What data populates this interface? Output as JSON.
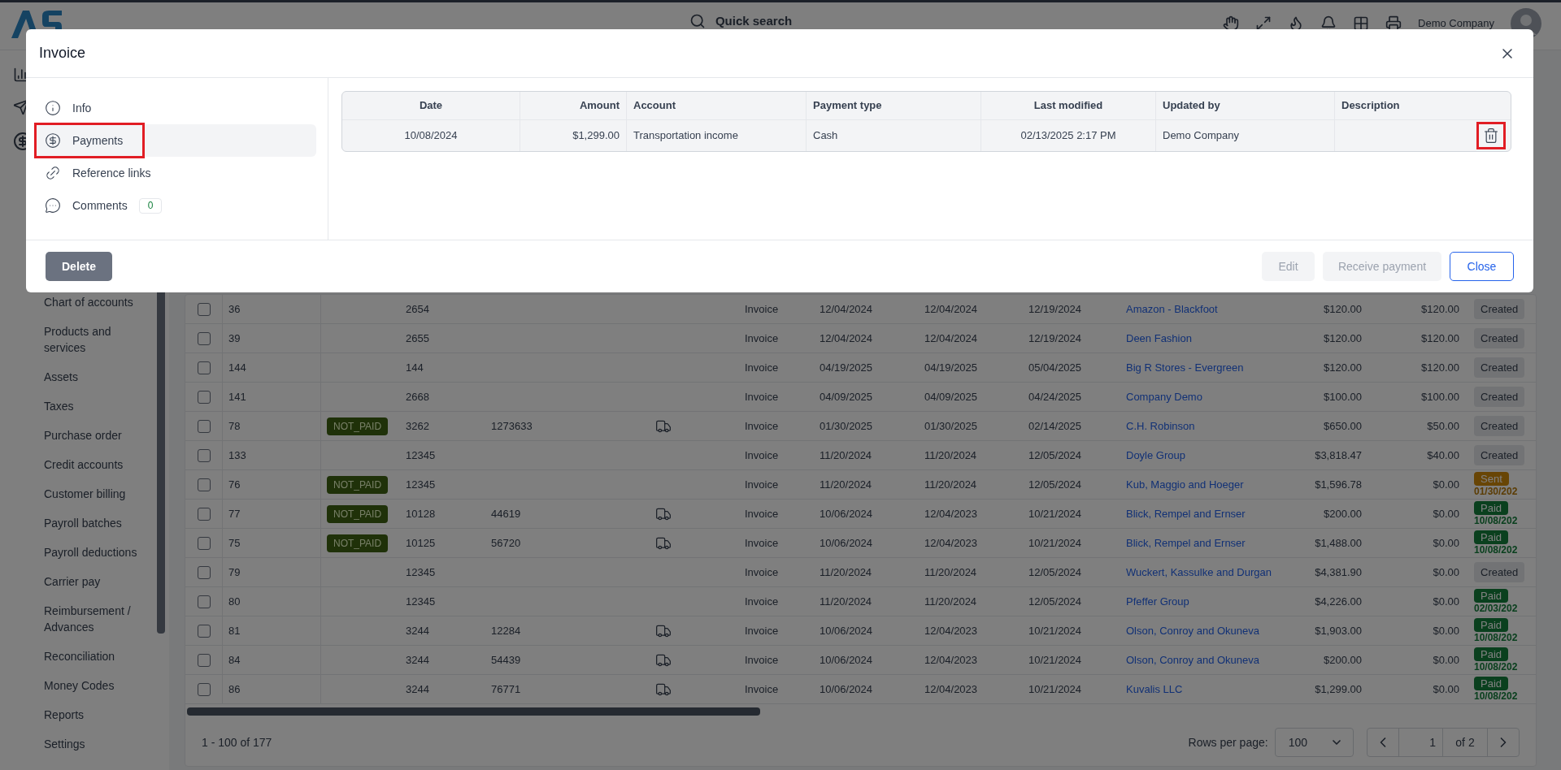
{
  "top_bar": {
    "search_placeholder": "Quick search",
    "company": "Demo Company"
  },
  "sidebar": {
    "items": [
      {
        "label": "Chart of accounts"
      },
      {
        "label": "Products and services"
      },
      {
        "label": "Assets"
      },
      {
        "label": "Taxes"
      },
      {
        "label": "Purchase order"
      },
      {
        "label": "Credit accounts"
      },
      {
        "label": "Customer billing"
      },
      {
        "label": "Payroll batches"
      },
      {
        "label": "Payroll deductions"
      },
      {
        "label": "Carrier pay"
      },
      {
        "label": "Reimbursement / Advances"
      },
      {
        "label": "Reconciliation"
      },
      {
        "label": "Money Codes"
      },
      {
        "label": "Reports"
      },
      {
        "label": "Settings"
      }
    ]
  },
  "table": {
    "rows": [
      {
        "checked": false,
        "column_1": "36",
        "column_3": "2654",
        "truck": false,
        "column_6": "Invoice",
        "column_7": "12/04/2024",
        "column_8": "12/04/2024",
        "column_9": "12/19/2024",
        "customer": "Amazon - Blackfoot",
        "amount": "$120.00",
        "balance": "$120.00",
        "status": {
          "kind": "created",
          "label": "Created"
        }
      },
      {
        "checked": false,
        "column_1": "39",
        "column_3": "2655",
        "truck": false,
        "column_6": "Invoice",
        "column_7": "12/04/2024",
        "column_8": "12/04/2024",
        "column_9": "12/19/2024",
        "customer": "Deen Fashion",
        "amount": "$120.00",
        "balance": "$120.00",
        "status": {
          "kind": "created",
          "label": "Created"
        }
      },
      {
        "checked": false,
        "column_1": "144",
        "column_3": "144",
        "truck": false,
        "column_6": "Invoice",
        "column_7": "04/19/2025",
        "column_8": "04/19/2025",
        "column_9": "05/04/2025",
        "customer": "Big R Stores - Evergreen",
        "amount": "$120.00",
        "balance": "$120.00",
        "status": {
          "kind": "created",
          "label": "Created"
        }
      },
      {
        "checked": false,
        "column_1": "141",
        "column_3": "2668",
        "truck": false,
        "column_6": "Invoice",
        "column_7": "04/09/2025",
        "column_8": "04/09/2025",
        "column_9": "04/24/2025",
        "customer": "Company Demo",
        "amount": "$100.00",
        "balance": "$100.00",
        "status": {
          "kind": "created",
          "label": "Created"
        }
      },
      {
        "checked": false,
        "column_1": "78",
        "column_2": "NOT_PAID",
        "column_3": "3262",
        "column_4": "1273633",
        "truck": true,
        "column_6": "Invoice",
        "column_7": "01/30/2025",
        "column_8": "01/30/2025",
        "column_9": "02/14/2025",
        "customer": "C.H. Robinson",
        "amount": "$650.00",
        "balance": "$50.00",
        "status": {
          "kind": "created",
          "label": "Created"
        }
      },
      {
        "checked": false,
        "column_1": "133",
        "column_3": "12345",
        "truck": false,
        "column_6": "Invoice",
        "column_7": "11/20/2024",
        "column_8": "11/20/2024",
        "column_9": "12/05/2024",
        "customer": "Doyle Group",
        "amount": "$3,818.47",
        "balance": "$40.00",
        "status": {
          "kind": "created",
          "label": "Created"
        }
      },
      {
        "checked": false,
        "column_1": "76",
        "column_2": "NOT_PAID",
        "column_3": "12345",
        "truck": false,
        "column_6": "Invoice",
        "column_7": "11/20/2024",
        "column_8": "11/20/2024",
        "column_9": "12/05/2024",
        "customer": "Kub, Maggio and Hoeger",
        "amount": "$1,596.78",
        "balance": "$0.00",
        "status": {
          "kind": "sent",
          "label": "Sent",
          "date": "01/30/202"
        }
      },
      {
        "checked": false,
        "column_1": "77",
        "column_2": "NOT_PAID",
        "column_3": "10128",
        "column_4": "44619",
        "truck": true,
        "column_6": "Invoice",
        "column_7": "10/06/2024",
        "column_8": "12/04/2023",
        "column_9": "10/21/2024",
        "customer": "Blick, Rempel and Ernser",
        "amount": "$200.00",
        "balance": "$0.00",
        "status": {
          "kind": "paid",
          "label": "Paid",
          "date": "10/08/202"
        }
      },
      {
        "checked": false,
        "column_1": "75",
        "column_2": "NOT_PAID",
        "column_3": "10125",
        "column_4": "56720",
        "truck": true,
        "column_6": "Invoice",
        "column_7": "10/06/2024",
        "column_8": "12/04/2023",
        "column_9": "10/21/2024",
        "customer": "Blick, Rempel and Ernser",
        "amount": "$1,488.00",
        "balance": "$0.00",
        "status": {
          "kind": "paid",
          "label": "Paid",
          "date": "10/08/202"
        }
      },
      {
        "checked": false,
        "column_1": "79",
        "column_3": "12345",
        "truck": false,
        "column_6": "Invoice",
        "column_7": "11/20/2024",
        "column_8": "11/20/2024",
        "column_9": "12/05/2024",
        "customer": "Wuckert, Kassulke and Durgan",
        "amount": "$4,381.90",
        "balance": "$0.00",
        "status": {
          "kind": "created",
          "label": "Created"
        }
      },
      {
        "checked": false,
        "column_1": "80",
        "column_3": "12345",
        "truck": false,
        "column_6": "Invoice",
        "column_7": "11/20/2024",
        "column_8": "11/20/2024",
        "column_9": "12/05/2024",
        "customer": "Pfeffer Group",
        "amount": "$4,226.00",
        "balance": "$0.00",
        "status": {
          "kind": "paid",
          "label": "Paid",
          "date": "02/03/202"
        }
      },
      {
        "checked": false,
        "column_1": "81",
        "column_3": "3244",
        "column_4": "12284",
        "truck": true,
        "column_6": "Invoice",
        "column_7": "10/06/2024",
        "column_8": "12/04/2023",
        "column_9": "10/21/2024",
        "customer": "Olson, Conroy and Okuneva",
        "amount": "$1,903.00",
        "balance": "$0.00",
        "status": {
          "kind": "paid",
          "label": "Paid",
          "date": "10/08/202"
        }
      },
      {
        "checked": false,
        "column_1": "84",
        "column_3": "3244",
        "column_4": "54439",
        "truck": true,
        "column_6": "Invoice",
        "column_7": "10/06/2024",
        "column_8": "12/04/2023",
        "column_9": "10/21/2024",
        "customer": "Olson, Conroy and Okuneva",
        "amount": "$200.00",
        "balance": "$0.00",
        "status": {
          "kind": "paid",
          "label": "Paid",
          "date": "10/08/202"
        }
      },
      {
        "checked": false,
        "column_1": "86",
        "column_3": "3244",
        "column_4": "76771",
        "truck": true,
        "column_6": "Invoice",
        "column_7": "10/06/2024",
        "column_8": "12/04/2023",
        "column_9": "10/21/2024",
        "customer": "Kuvalis LLC",
        "amount": "$1,299.00",
        "balance": "$0.00",
        "status": {
          "kind": "paid",
          "label": "Paid",
          "date": "10/08/202"
        }
      }
    ]
  },
  "pagination": {
    "range": "1 - 100 of 177",
    "rows_per_page_label": "Rows per page:",
    "rows_per_page": "100",
    "page": "1",
    "of_pages": "of 2"
  },
  "modal": {
    "title": "Invoice",
    "nav": [
      {
        "kind": "info",
        "label": "Info",
        "selected": false,
        "highlighted": false
      },
      {
        "kind": "payments",
        "label": "Payments",
        "selected": true,
        "highlighted": true
      },
      {
        "kind": "links",
        "label": "Reference links",
        "selected": false,
        "highlighted": false
      },
      {
        "kind": "comments",
        "label": "Comments",
        "count": "0",
        "selected": false,
        "highlighted": false
      }
    ],
    "payments": {
      "columns": [
        "Date",
        "Amount",
        "Account",
        "Payment type",
        "Last modified",
        "Updated by",
        "Description"
      ],
      "rows": [
        {
          "date": "10/08/2024",
          "amount": "$1,299.00",
          "account": "Transportation income",
          "payment_type": "Cash",
          "last_modified": "02/13/2025 2:17 PM",
          "updated_by": "Demo Company",
          "delete_highlighted": true
        }
      ]
    },
    "buttons": {
      "delete": "Delete",
      "edit": "Edit",
      "receive_payment": "Receive payment",
      "close": "Close"
    }
  }
}
